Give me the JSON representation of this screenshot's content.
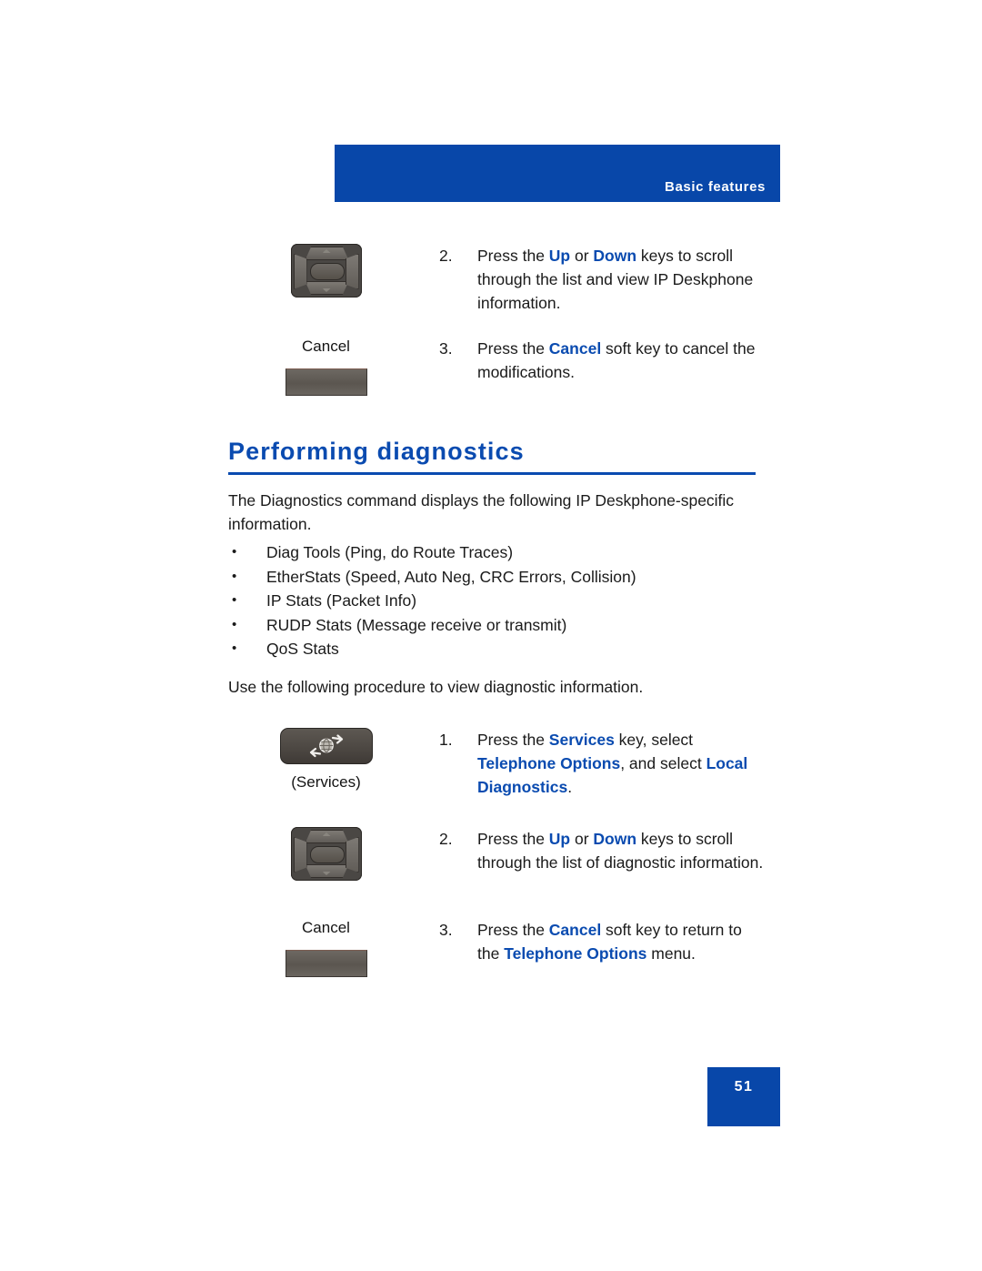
{
  "header": {
    "title": "Basic features",
    "bar_color": "#0847a9"
  },
  "top_steps": [
    {
      "number": "2.",
      "art": "navigation-cluster-key",
      "caption": "",
      "text_runs": [
        {
          "t": "Press the ",
          "style": "plain"
        },
        {
          "t": "Up",
          "style": "bold-blue"
        },
        {
          "t": " or ",
          "style": "plain"
        },
        {
          "t": "Down",
          "style": "bold-blue"
        },
        {
          "t": " keys to scroll through the list and view IP Deskphone information.",
          "style": "plain"
        }
      ]
    },
    {
      "number": "3.",
      "art": "soft-key",
      "caption": "Cancel",
      "text_runs": [
        {
          "t": "Press the ",
          "style": "plain"
        },
        {
          "t": "Cancel",
          "style": "bold-blue"
        },
        {
          "t": " soft key to cancel the modifications.",
          "style": "plain"
        }
      ]
    }
  ],
  "section": {
    "heading": "Performing diagnostics",
    "heading_color": "#0a4bb0",
    "intro": "The Diagnostics command displays the following IP Deskphone-specific information.",
    "bullets": [
      "Diag Tools (Ping, do Route Traces)",
      "EtherStats (Speed, Auto Neg, CRC Errors, Collision)",
      "IP Stats (Packet Info)",
      "RUDP Stats (Message receive or transmit)",
      "QoS Stats"
    ],
    "procedure_intro": "Use the following procedure to view diagnostic information."
  },
  "procedure_steps": [
    {
      "number": "1.",
      "art": "services-key",
      "caption": "(Services)",
      "text_runs": [
        {
          "t": "Press the ",
          "style": "plain"
        },
        {
          "t": "Services",
          "style": "bold-blue"
        },
        {
          "t": " key, select ",
          "style": "plain"
        },
        {
          "t": "Telephone Options",
          "style": "bold-blue"
        },
        {
          "t": ", and select ",
          "style": "plain"
        },
        {
          "t": "Local Diagnostics",
          "style": "bold-blue"
        },
        {
          "t": ".",
          "style": "plain"
        }
      ]
    },
    {
      "number": "2.",
      "art": "navigation-cluster-key",
      "caption": "",
      "text_runs": [
        {
          "t": "Press the ",
          "style": "plain"
        },
        {
          "t": "Up",
          "style": "bold-blue"
        },
        {
          "t": " or ",
          "style": "plain"
        },
        {
          "t": "Down",
          "style": "bold-blue"
        },
        {
          "t": " keys to scroll through the list of diagnostic information.",
          "style": "plain"
        }
      ]
    },
    {
      "number": "3.",
      "art": "soft-key",
      "caption": "Cancel",
      "text_runs": [
        {
          "t": "Press the ",
          "style": "plain"
        },
        {
          "t": "Cancel",
          "style": "bold-blue"
        },
        {
          "t": " soft key to return to the ",
          "style": "plain"
        },
        {
          "t": "Telephone Options",
          "style": "bold-blue"
        },
        {
          "t": " menu.",
          "style": "plain"
        }
      ]
    }
  ],
  "footer": {
    "page_number": "51",
    "box_color": "#0847a9"
  }
}
